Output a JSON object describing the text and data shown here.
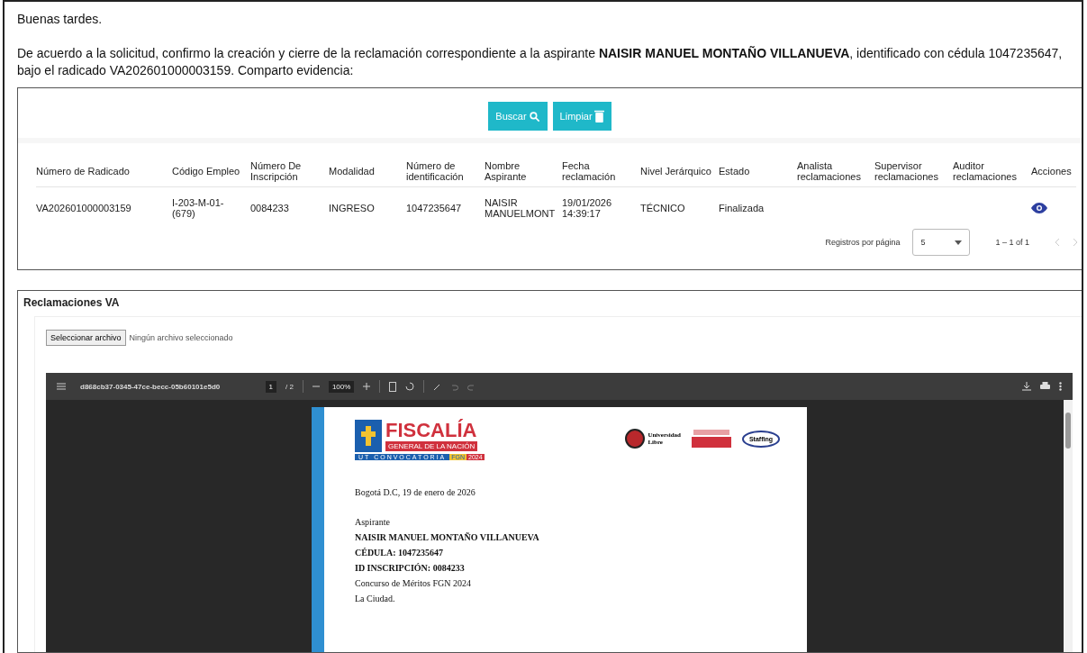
{
  "email": {
    "greeting": "Buenas tardes.",
    "body": "De acuerdo a la solicitud, confirmo la creación y cierre de la reclamación correspondiente a la aspirante **NAISIR MANUEL MONTAÑO VILLANUEVA**, identificado con cédula 1047235647, bajo el radicado VA202601000003159. Comparto evidencia:"
  },
  "search_panel": {
    "buttons": [
      {
        "label": "Buscar",
        "kind": "search"
      },
      {
        "label": "Limpiar",
        "kind": "clear"
      }
    ],
    "table": {
      "columns": [
        "Número de Radicado",
        "Código Empleo",
        "Número De Inscripción",
        "Modalidad",
        "Número de identificación",
        "Nombre Aspirante",
        "Fecha reclamación",
        "Nivel Jerárquico",
        "Estado",
        "Analista reclamaciones",
        "Supervisor reclamaciones",
        "Auditor reclamaciones",
        "Acciones"
      ],
      "rows": [
        {
          "cells": [
            "VA202601000003159",
            "I-203-M-01-(679)",
            "0084233",
            "INGRESO",
            "1047235647",
            "NAISIR MANUELMONT",
            "19/01/2026 14:39:17",
            "TÉCNICO",
            "Finalizada"
          ]
        }
      ]
    },
    "pagination": {
      "label": "Registros por página",
      "page_size": "5",
      "range": "1 – 1 of 1"
    }
  },
  "claims_panel": {
    "title": "Reclamaciones VA",
    "file_button": "Seleccionar archivo",
    "file_status": "Ningún archivo seleccionado",
    "pdf_viewer": {
      "file_name": "d868cb37-0345-47ce-becc-05b60101e5d0",
      "page": "1",
      "page_total": "/ 2",
      "zoom": "100%"
    },
    "document": {
      "logo": {
        "title": "FISCALÍA",
        "subtitle": "GENERAL DE LA NACIÓN",
        "band": "UT CONVOCATORIA",
        "band_tag": "FGN",
        "band_year": "2024"
      },
      "partners": [
        {
          "kind": "university",
          "top": "Universidad",
          "bottom": "Libre"
        },
        {
          "kind": "badge"
        },
        {
          "kind": "ring",
          "top": "Staffing"
        }
      ],
      "lines": [
        {
          "text": "Bogotá D.C, 19 de enero de 2026",
          "bold": false
        },
        {
          "text": "Aspirante",
          "bold": false
        },
        {
          "text": "NAISIR MANUEL MONTAÑO VILLANUEVA",
          "bold": true
        },
        {
          "text": "CÉDULA: 1047235647",
          "bold": true
        },
        {
          "text": "ID INSCRIPCIÓN: 0084233",
          "bold": true
        },
        {
          "text": "Concurso de Méritos FGN 2024",
          "bold": false
        },
        {
          "text": "La Ciudad.",
          "bold": false
        }
      ]
    }
  }
}
